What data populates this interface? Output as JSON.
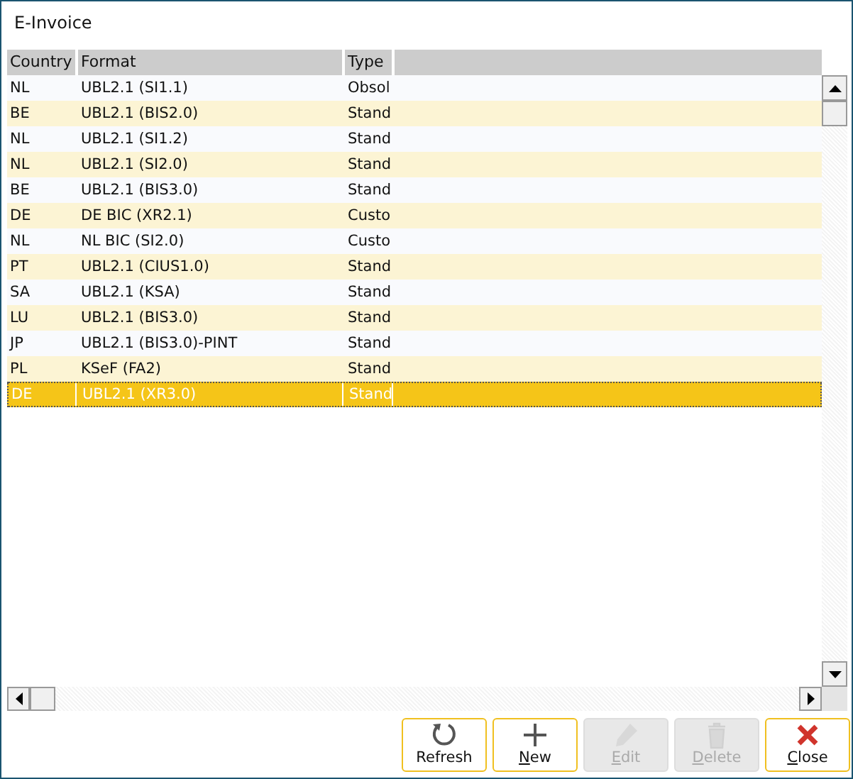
{
  "window": {
    "title": "E-Invoice"
  },
  "table": {
    "columns": [
      "Country",
      "Format",
      "Type"
    ],
    "rows": [
      {
        "country": "NL",
        "format": "UBL2.1 (SI1.1)",
        "type": "Obsol",
        "selected": false
      },
      {
        "country": "BE",
        "format": "UBL2.1 (BIS2.0)",
        "type": "Stand",
        "selected": false
      },
      {
        "country": "NL",
        "format": "UBL2.1 (SI1.2)",
        "type": "Stand",
        "selected": false
      },
      {
        "country": "NL",
        "format": "UBL2.1 (SI2.0)",
        "type": "Stand",
        "selected": false
      },
      {
        "country": "BE",
        "format": "UBL2.1 (BIS3.0)",
        "type": "Stand",
        "selected": false
      },
      {
        "country": "DE",
        "format": "DE BIC (XR2.1)",
        "type": "Custo",
        "selected": false
      },
      {
        "country": "NL",
        "format": "NL BIC (SI2.0)",
        "type": "Custo",
        "selected": false
      },
      {
        "country": "PT",
        "format": "UBL2.1 (CIUS1.0)",
        "type": "Stand",
        "selected": false
      },
      {
        "country": "SA",
        "format": "UBL2.1 (KSA)",
        "type": "Stand",
        "selected": false
      },
      {
        "country": "LU",
        "format": "UBL2.1 (BIS3.0)",
        "type": "Stand",
        "selected": false
      },
      {
        "country": "JP",
        "format": "UBL2.1 (BIS3.0)-PINT",
        "type": "Stand",
        "selected": false
      },
      {
        "country": "PL",
        "format": "KSeF (FA2)",
        "type": "Stand",
        "selected": false
      },
      {
        "country": "DE",
        "format": "UBL2.1 (XR3.0)",
        "type": "Stand",
        "selected": true
      }
    ]
  },
  "buttons": [
    {
      "kind": "refresh",
      "label": "Refresh",
      "mnemonic": false,
      "disabled": false
    },
    {
      "kind": "new",
      "label": "New",
      "mnemonic": true,
      "disabled": false
    },
    {
      "kind": "edit",
      "label": "Edit",
      "mnemonic": true,
      "disabled": true
    },
    {
      "kind": "delete",
      "label": "Delete",
      "mnemonic": true,
      "disabled": true
    },
    {
      "kind": "close",
      "label": "Close",
      "mnemonic": true,
      "disabled": false
    }
  ]
}
